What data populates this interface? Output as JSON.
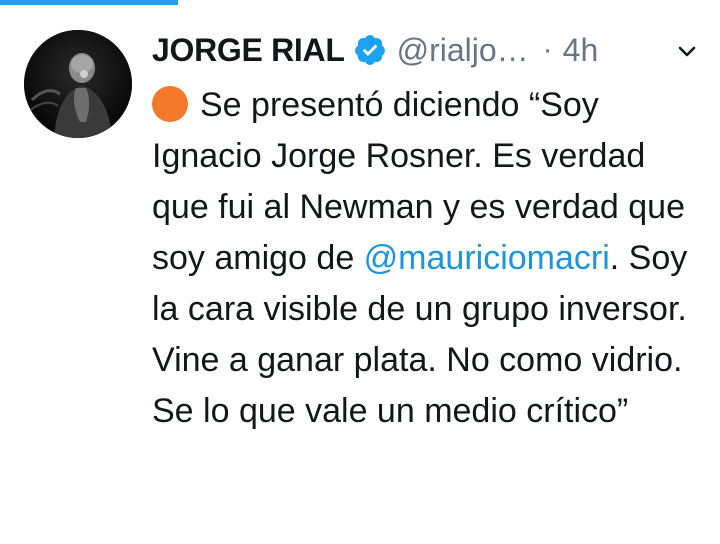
{
  "tweet": {
    "author_name": "JORGE RIAL",
    "handle": "@rialjo…",
    "separator": "·",
    "time": "4h",
    "text_part1": "Se presentó diciendo “Soy Ignacio Jorge Rosner. Es verdad que fui al Newman y es verdad que soy amigo de ",
    "mention": "@mauriciomacri",
    "text_part2": ". Soy la cara visible de un grupo inversor. Vine a ganar plata. No como vidrio. Se lo que vale un medio crítico”",
    "emoji": "orange-circle",
    "verified_icon": "verified-badge-icon",
    "menu_icon": "chevron-down-icon"
  },
  "colors": {
    "accent": "#1da1f2",
    "mention": "#1b95e0",
    "secondary_text": "#657786",
    "primary_text": "#14171a",
    "emoji_orange": "#f4772c"
  }
}
